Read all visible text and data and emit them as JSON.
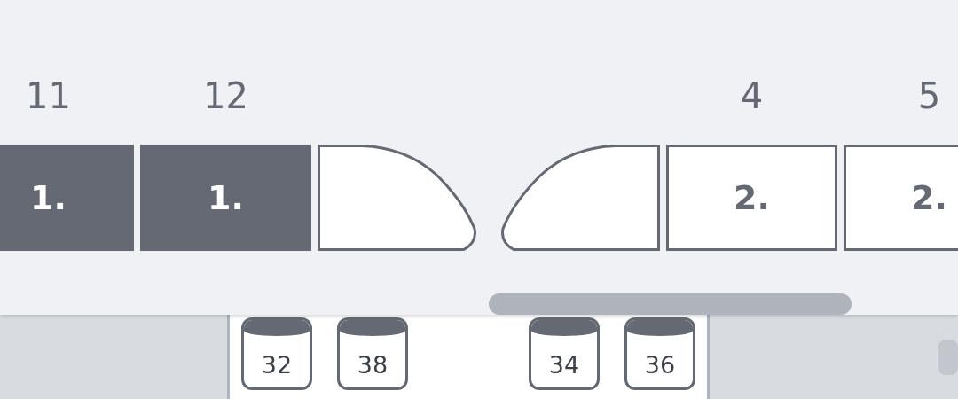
{
  "coaches": [
    {
      "number": "11",
      "kind": "first-class",
      "class_label": "1."
    },
    {
      "number": "12",
      "kind": "first-class",
      "class_label": "1."
    },
    {
      "kind": "nose-front"
    },
    {
      "kind": "nose-rear"
    },
    {
      "number": "4",
      "kind": "second-class",
      "class_label": "2."
    },
    {
      "number": "5",
      "kind": "second-class",
      "class_label": "2."
    }
  ],
  "seat_groups": [
    {
      "seats": [
        {
          "number": "32"
        },
        {
          "number": "38"
        }
      ]
    },
    {
      "seats": [
        {
          "number": "34"
        },
        {
          "number": "36"
        }
      ]
    }
  ]
}
